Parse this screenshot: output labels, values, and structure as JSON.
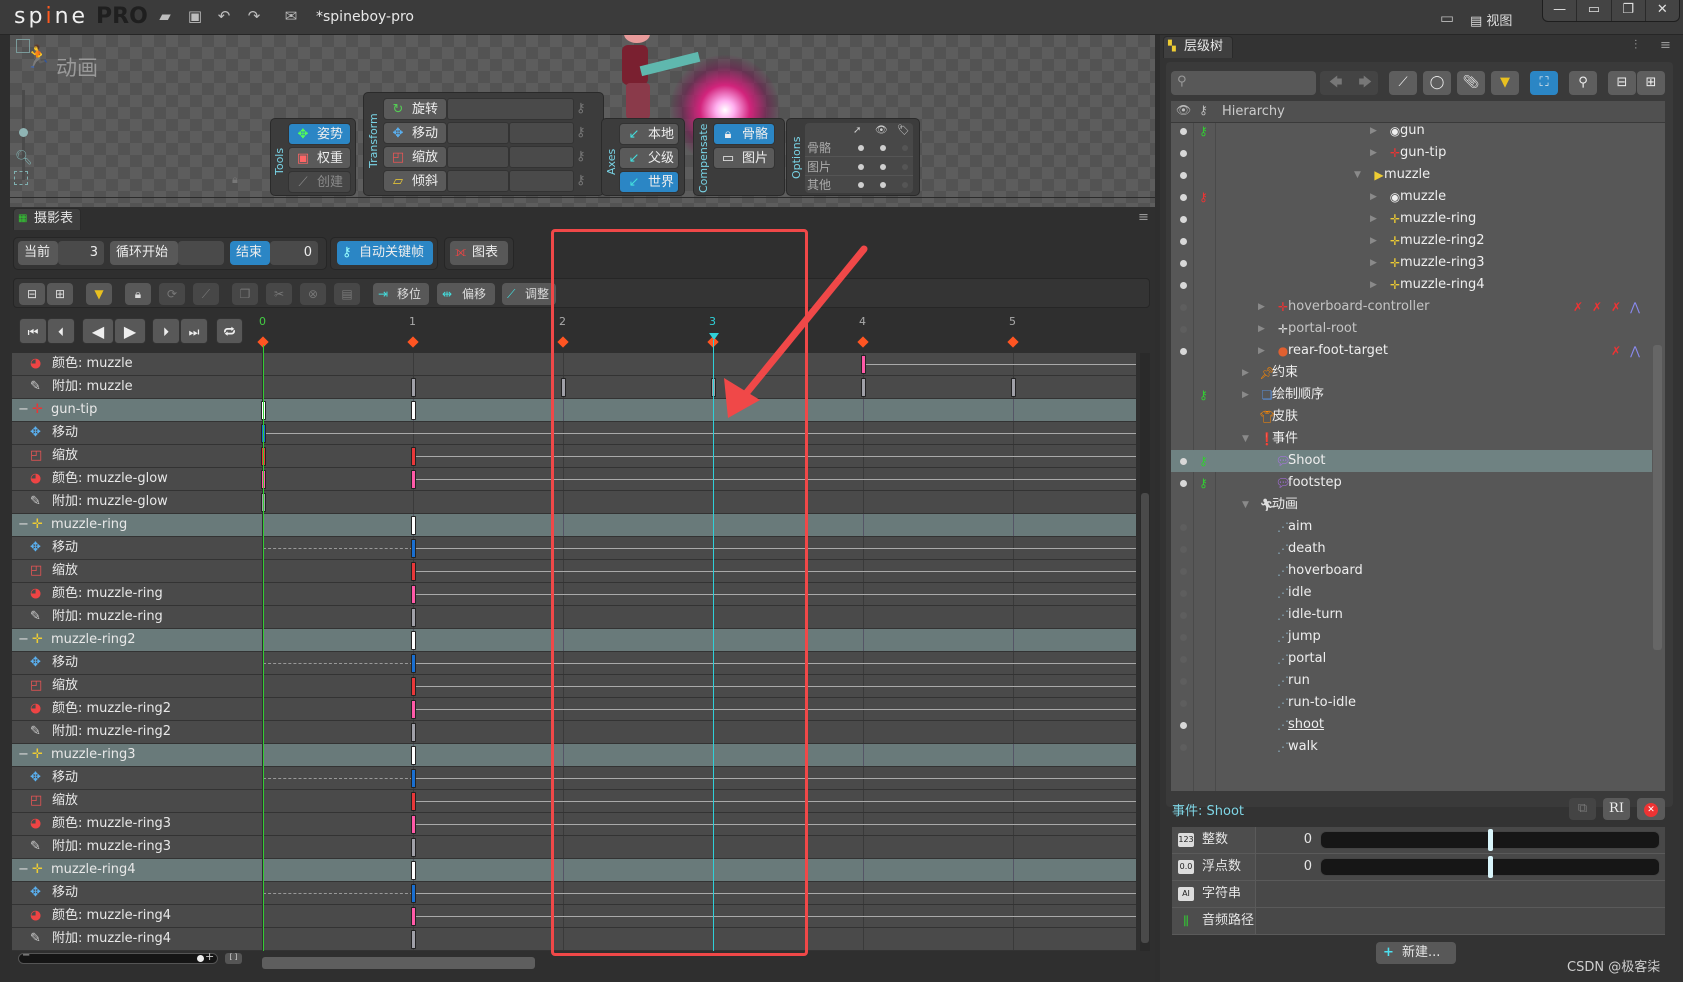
{
  "app": {
    "logo": "spine",
    "edition": "PRO",
    "document_title": "*spineboy-pro",
    "view_menu": "视图"
  },
  "toolbar_icons": [
    "open-folder-icon",
    "save-icon",
    "undo-icon",
    "redo-icon",
    "mail-icon"
  ],
  "viewport": {
    "mode_title": "动画",
    "tools": {
      "label": "Tools",
      "buttons": [
        {
          "label": "姿势",
          "active": true
        },
        {
          "label": "权重",
          "active": false
        },
        {
          "label": "创建",
          "active": false,
          "disabled": true
        }
      ]
    },
    "transform": {
      "label": "Transform",
      "buttons": [
        "旋转",
        "移动",
        "缩放",
        "倾斜"
      ]
    },
    "axes": {
      "label": "Axes",
      "buttons": [
        {
          "label": "本地",
          "active": false
        },
        {
          "label": "父级",
          "active": false
        },
        {
          "label": "世界",
          "active": true
        }
      ]
    },
    "compensate": {
      "label": "Compensate",
      "buttons": [
        {
          "label": "骨骼",
          "active": true
        },
        {
          "label": "图片",
          "active": false
        }
      ]
    },
    "options": {
      "label": "Options",
      "rows": [
        "骨骼",
        "图片",
        "其他"
      ]
    }
  },
  "dopesheet": {
    "tab_label": "摄影表",
    "current_label": "当前",
    "current_value": "3",
    "loop_start_label": "循环开始",
    "loop_start_value": "",
    "end_label": "结束",
    "end_value": "0",
    "autokey_label": "自动关键帧",
    "graph_label": "图表",
    "offset_buttons": [
      "移位",
      "偏移",
      "调整"
    ],
    "ruler_labels": [
      "0",
      "1",
      "2",
      "3",
      "4",
      "5"
    ],
    "current_frame": 3,
    "colors": {
      "translate": "#1a6fd0",
      "scale": "#e8383a",
      "color": "#ff5aa8",
      "attach": "#a0a0a8",
      "bone": "#ffffff",
      "playhead": "#2fd0d8",
      "annotation": "#f04848"
    },
    "tracks": [
      {
        "type": "color",
        "label": "颜色: muzzle",
        "keys": [
          4
        ],
        "line": true
      },
      {
        "type": "attach",
        "label": "附加: muzzle",
        "keys": [
          1,
          2,
          3,
          4,
          5
        ]
      },
      {
        "type": "bone",
        "label": "gun-tip",
        "bone_color": "red",
        "keys": [
          0,
          1
        ]
      },
      {
        "type": "translate",
        "label": "移动",
        "keys": [
          0
        ],
        "line": true
      },
      {
        "type": "scale",
        "label": "缩放",
        "keys": [
          0,
          1
        ],
        "line": true
      },
      {
        "type": "color",
        "label": "颜色: muzzle-glow",
        "keys": [
          0,
          1
        ],
        "line": true
      },
      {
        "type": "attach",
        "label": "附加: muzzle-glow",
        "keys": [
          0
        ]
      },
      {
        "type": "bone",
        "label": "muzzle-ring",
        "bone_color": "yellow",
        "keys": [
          1
        ]
      },
      {
        "type": "translate",
        "label": "移动",
        "keys": [
          1
        ],
        "line": true,
        "dashed_before": true
      },
      {
        "type": "scale",
        "label": "缩放",
        "keys": [
          1
        ],
        "line": true
      },
      {
        "type": "color",
        "label": "颜色: muzzle-ring",
        "keys": [
          1
        ],
        "line": true
      },
      {
        "type": "attach",
        "label": "附加: muzzle-ring",
        "keys": [
          1
        ]
      },
      {
        "type": "bone",
        "label": "muzzle-ring2",
        "bone_color": "yellow",
        "keys": [
          1
        ]
      },
      {
        "type": "translate",
        "label": "移动",
        "keys": [
          1
        ],
        "line": true,
        "dashed_before": true
      },
      {
        "type": "scale",
        "label": "缩放",
        "keys": [
          1
        ],
        "line": true
      },
      {
        "type": "color",
        "label": "颜色: muzzle-ring2",
        "keys": [
          1
        ],
        "line": true
      },
      {
        "type": "attach",
        "label": "附加: muzzle-ring2",
        "keys": [
          1
        ]
      },
      {
        "type": "bone",
        "label": "muzzle-ring3",
        "bone_color": "yellow",
        "keys": [
          1
        ]
      },
      {
        "type": "translate",
        "label": "移动",
        "keys": [
          1
        ],
        "line": true,
        "dashed_before": true
      },
      {
        "type": "scale",
        "label": "缩放",
        "keys": [
          1
        ],
        "line": true
      },
      {
        "type": "color",
        "label": "颜色: muzzle-ring3",
        "keys": [
          1
        ],
        "line": true
      },
      {
        "type": "attach",
        "label": "附加: muzzle-ring3",
        "keys": [
          1
        ]
      },
      {
        "type": "bone",
        "label": "muzzle-ring4",
        "bone_color": "yellow",
        "keys": [
          1
        ]
      },
      {
        "type": "translate",
        "label": "移动",
        "keys": [
          1
        ],
        "line": true,
        "dashed_before": true
      },
      {
        "type": "color",
        "label": "颜色: muzzle-ring4",
        "keys": [
          1
        ],
        "line": true
      },
      {
        "type": "attach",
        "label": "附加: muzzle-ring4",
        "keys": [
          1
        ]
      }
    ]
  },
  "hierarchy": {
    "tab_label": "层级树",
    "header": "Hierarchy",
    "search_placeholder": "",
    "rows": [
      {
        "label": "gun",
        "level": 9,
        "icon": "attachment-point",
        "arrow": "right",
        "eye": "on",
        "key": "green"
      },
      {
        "label": "gun-tip",
        "level": 9,
        "icon": "bone-red",
        "arrow": "right",
        "eye": "on"
      },
      {
        "label": "muzzle",
        "level": 8,
        "icon": "slot-folder",
        "arrow": "down",
        "eye": "on"
      },
      {
        "label": "muzzle",
        "level": 9,
        "icon": "attachment-point",
        "arrow": "right",
        "eye": "on",
        "key": "red"
      },
      {
        "label": "muzzle-ring",
        "level": 9,
        "icon": "bone-yellow",
        "arrow": "right",
        "eye": "on"
      },
      {
        "label": "muzzle-ring2",
        "level": 9,
        "icon": "bone-yellow",
        "arrow": "right",
        "eye": "on"
      },
      {
        "label": "muzzle-ring3",
        "level": 9,
        "icon": "bone-yellow",
        "arrow": "right",
        "eye": "on"
      },
      {
        "label": "muzzle-ring4",
        "level": 9,
        "icon": "bone-yellow",
        "arrow": "right",
        "eye": "on"
      },
      {
        "label": "hoverboard-controller",
        "level": 2,
        "icon": "bone-red",
        "arrow": "right",
        "eye": "off",
        "dim": true,
        "constraints": 4
      },
      {
        "label": "portal-root",
        "level": 2,
        "icon": "bone-white",
        "arrow": "right",
        "eye": "off",
        "dim": true
      },
      {
        "label": "rear-foot-target",
        "level": 2,
        "icon": "target",
        "arrow": "right",
        "eye": "on",
        "constraints": 2
      },
      {
        "label": "约束",
        "level": 1,
        "icon": "constraint",
        "arrow": "right"
      },
      {
        "label": "绘制顺序",
        "level": 1,
        "icon": "draw-order",
        "arrow": "right",
        "key": "green"
      },
      {
        "label": "皮肤",
        "level": 1,
        "icon": "skin"
      },
      {
        "label": "事件",
        "level": 1,
        "icon": "events",
        "arrow": "down"
      },
      {
        "label": "Shoot",
        "level": 2,
        "icon": "event",
        "eye": "on",
        "key": "green",
        "selected": true
      },
      {
        "label": "footstep",
        "level": 2,
        "icon": "event",
        "eye": "on",
        "key": "green"
      },
      {
        "label": "动画",
        "level": 1,
        "icon": "animations",
        "arrow": "down"
      },
      {
        "label": "aim",
        "level": 2,
        "icon": "animation",
        "eye": "off"
      },
      {
        "label": "death",
        "level": 2,
        "icon": "animation",
        "eye": "off"
      },
      {
        "label": "hoverboard",
        "level": 2,
        "icon": "animation",
        "eye": "off"
      },
      {
        "label": "idle",
        "level": 2,
        "icon": "animation",
        "eye": "off"
      },
      {
        "label": "idle-turn",
        "level": 2,
        "icon": "animation",
        "eye": "off"
      },
      {
        "label": "jump",
        "level": 2,
        "icon": "animation",
        "eye": "off"
      },
      {
        "label": "portal",
        "level": 2,
        "icon": "animation",
        "eye": "off"
      },
      {
        "label": "run",
        "level": 2,
        "icon": "animation",
        "eye": "off"
      },
      {
        "label": "run-to-idle",
        "level": 2,
        "icon": "animation",
        "eye": "off"
      },
      {
        "label": "shoot",
        "level": 2,
        "icon": "animation",
        "eye": "on",
        "active": true
      },
      {
        "label": "walk",
        "level": 2,
        "icon": "animation",
        "eye": "off"
      }
    ]
  },
  "event_props": {
    "title": "事件: Shoot",
    "rows": [
      {
        "label": "整数",
        "icon": "123",
        "value": "0",
        "slider": 0.5
      },
      {
        "label": "浮点数",
        "icon": "0.0",
        "value": "0",
        "slider": 0.5
      },
      {
        "label": "字符串",
        "icon": "AI",
        "value": ""
      },
      {
        "label": "音频路径",
        "icon": "audio",
        "value": ""
      }
    ],
    "new_button": "新建..."
  },
  "watermark": "CSDN @极客柒"
}
